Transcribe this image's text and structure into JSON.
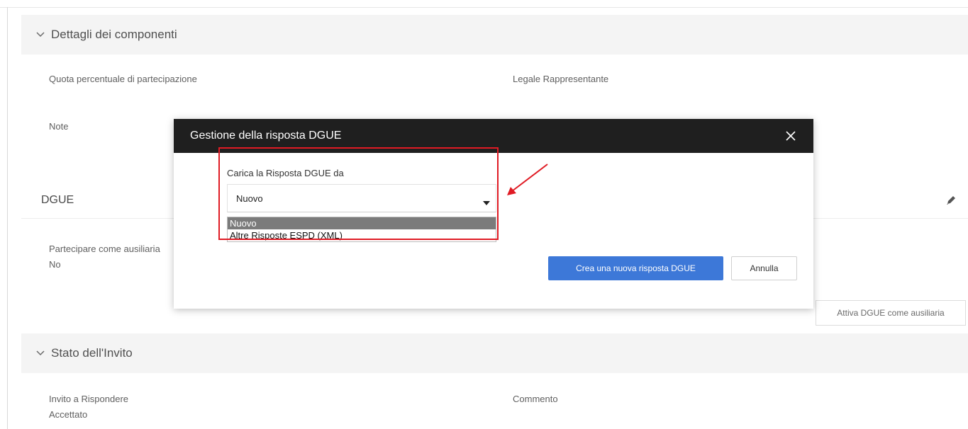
{
  "section_components": {
    "title": "Dettagli dei componenti",
    "icon": "chevron-down-icon"
  },
  "fields": {
    "quota_label": "Quota percentuale di partecipazione",
    "legale_label": "Legale Rappresentante",
    "note_label": "Note"
  },
  "dgue": {
    "title": "DGUE",
    "edit_icon": "pencil-icon",
    "ausiliaria_label": "Partecipare come ausiliaria",
    "ausiliaria_value": "No",
    "attiva_button": "Attiva DGUE come ausiliaria"
  },
  "section_invito": {
    "title": "Stato dell'Invito",
    "icon": "chevron-down-icon",
    "invito_label": "Invito a Rispondere",
    "invito_value": "Accettato",
    "commento_label": "Commento"
  },
  "modal": {
    "title": "Gestione della risposta DGUE",
    "close_icon": "close-icon",
    "field_label": "Carica la Risposta DGUE da",
    "select_value": "Nuovo",
    "options": [
      "Nuovo",
      "Altre Risposte ESPD (XML)"
    ],
    "selected_option": "Nuovo",
    "primary_button": "Crea una nuova risposta DGUE",
    "cancel_button": "Annulla"
  },
  "annotation": {
    "color": "#e01b24"
  },
  "colors": {
    "primary": "#3d78d8",
    "modal_header": "#1f1f1f",
    "section_bg": "#f4f4f4"
  }
}
